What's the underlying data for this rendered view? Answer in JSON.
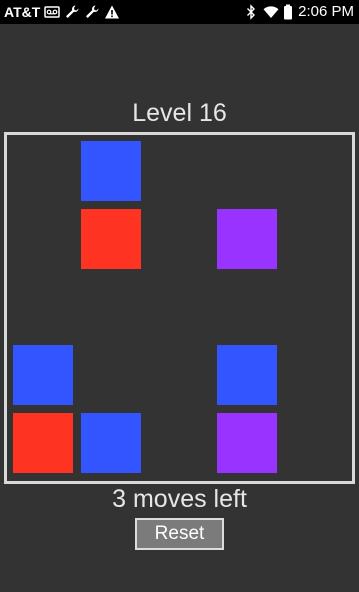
{
  "status_bar": {
    "carrier": "AT&T",
    "time": "2:06 PM",
    "icons_left": [
      "voicemail-icon",
      "wrench-icon",
      "wrench-icon",
      "warning-icon"
    ],
    "icons_right": [
      "bluetooth-icon",
      "wifi-icon",
      "battery-icon"
    ]
  },
  "game": {
    "level_title": "Level 16",
    "moves_text": "3 moves left",
    "reset_label": "Reset",
    "colors": {
      "blue": "#3355ff",
      "red": "#ff3322",
      "purple": "#9933ff",
      "background": "#333333",
      "board_border": "#d9d9d9"
    },
    "board": {
      "columns": 5,
      "rows": 5,
      "tiles": [
        {
          "row": 0,
          "col": 1,
          "color": "blue"
        },
        {
          "row": 1,
          "col": 1,
          "color": "red"
        },
        {
          "row": 1,
          "col": 3,
          "color": "purple"
        },
        {
          "row": 3,
          "col": 0,
          "color": "blue"
        },
        {
          "row": 3,
          "col": 3,
          "color": "blue"
        },
        {
          "row": 4,
          "col": 0,
          "color": "red"
        },
        {
          "row": 4,
          "col": 1,
          "color": "blue"
        },
        {
          "row": 4,
          "col": 3,
          "color": "purple"
        }
      ]
    }
  }
}
